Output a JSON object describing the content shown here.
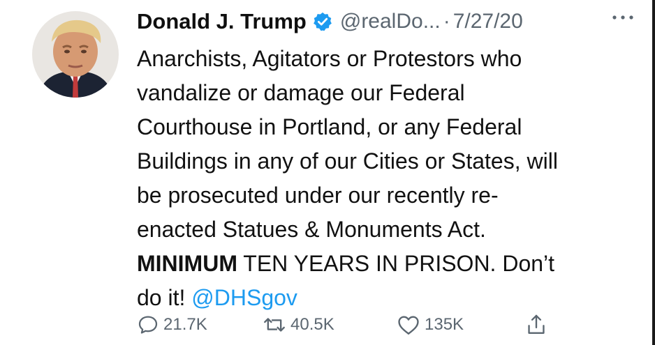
{
  "tweet": {
    "author_name": "Donald J. Trump",
    "handle": "@realDo...",
    "separator": "·",
    "date": "7/27/20",
    "lines": [
      "Anarchists, Agitators or Protestors who",
      "vandalize or damage our Federal",
      "Courthouse in Portland, or any Federal",
      "Buildings in any of our Cities or States, will",
      "be prosecuted under our recently re-",
      "enacted Statues & Monuments Act."
    ],
    "line7_bold": "MINIMUM",
    "line7_rest": " TEN YEARS IN PRISON. Don’t",
    "line8_text": "do it! ",
    "mention": "@DHSgov"
  },
  "actions": {
    "reply_count": "21.7K",
    "retweet_count": "40.5K",
    "like_count": "135K"
  },
  "icons": {
    "verified": "verified-badge-icon",
    "more": "more-options-icon",
    "reply": "reply-icon",
    "retweet": "retweet-icon",
    "like": "heart-icon",
    "share": "share-icon"
  },
  "colors": {
    "verified": "#1d9bf0",
    "mention": "#1d9bf0",
    "secondary_text": "#5b6670",
    "primary_text": "#111111"
  }
}
